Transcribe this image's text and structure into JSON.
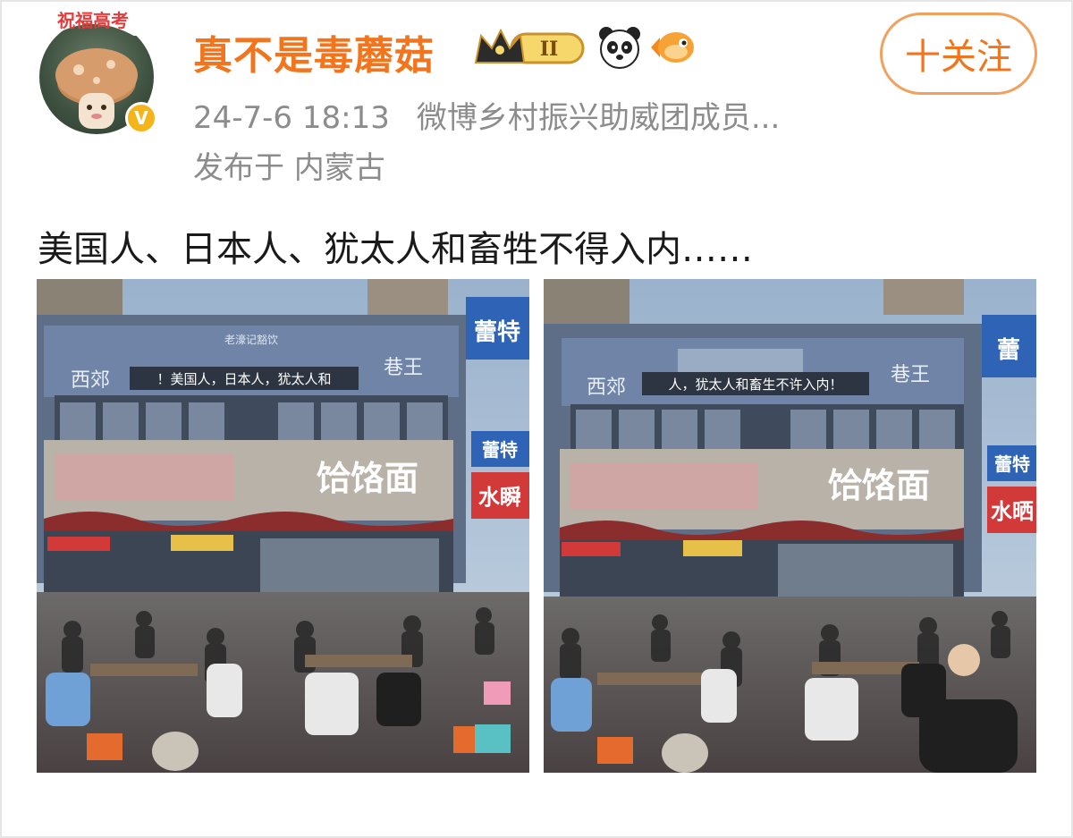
{
  "post": {
    "author": {
      "name": "真不是毒蘑菇",
      "avatar_banner": "祝福高考",
      "verified_mark": "V",
      "level_badge": "II"
    },
    "follow_button": "十关注",
    "timestamp": "24-7-6 18:13",
    "author_title": "微博乡村振兴助威团成员...",
    "location": "发布于 内蒙古",
    "text": "美国人、日本人、犹太人和畜牲不得入内……"
  },
  "photos": [
    {
      "small_sign": "老濠记豁饮",
      "sign_left": "西郊",
      "sign_right": "巷王",
      "banner": "！美国人，日本人，犹太人和",
      "shop_name": "饸饹面",
      "side_sign_1": "蕾特",
      "side_sign_2": "蕾特",
      "side_sign_3": "水瞬"
    },
    {
      "sign_left": "西郊",
      "sign_right": "巷王",
      "banner": "人，犹太人和畜生不许入内！",
      "shop_name": "饸饹面",
      "side_sign_1": "蕾",
      "side_sign_2": "蕾特",
      "side_sign_3": "水晒"
    }
  ],
  "colors": {
    "username": "#f2751d",
    "meta": "#8c8c8c",
    "follow_border": "#f2a05d",
    "verified": "#f4b51b"
  },
  "icons": [
    "mushroom-avatar",
    "verified-badge-icon",
    "crown-level-icon",
    "panda-icon",
    "fish-icon"
  ]
}
